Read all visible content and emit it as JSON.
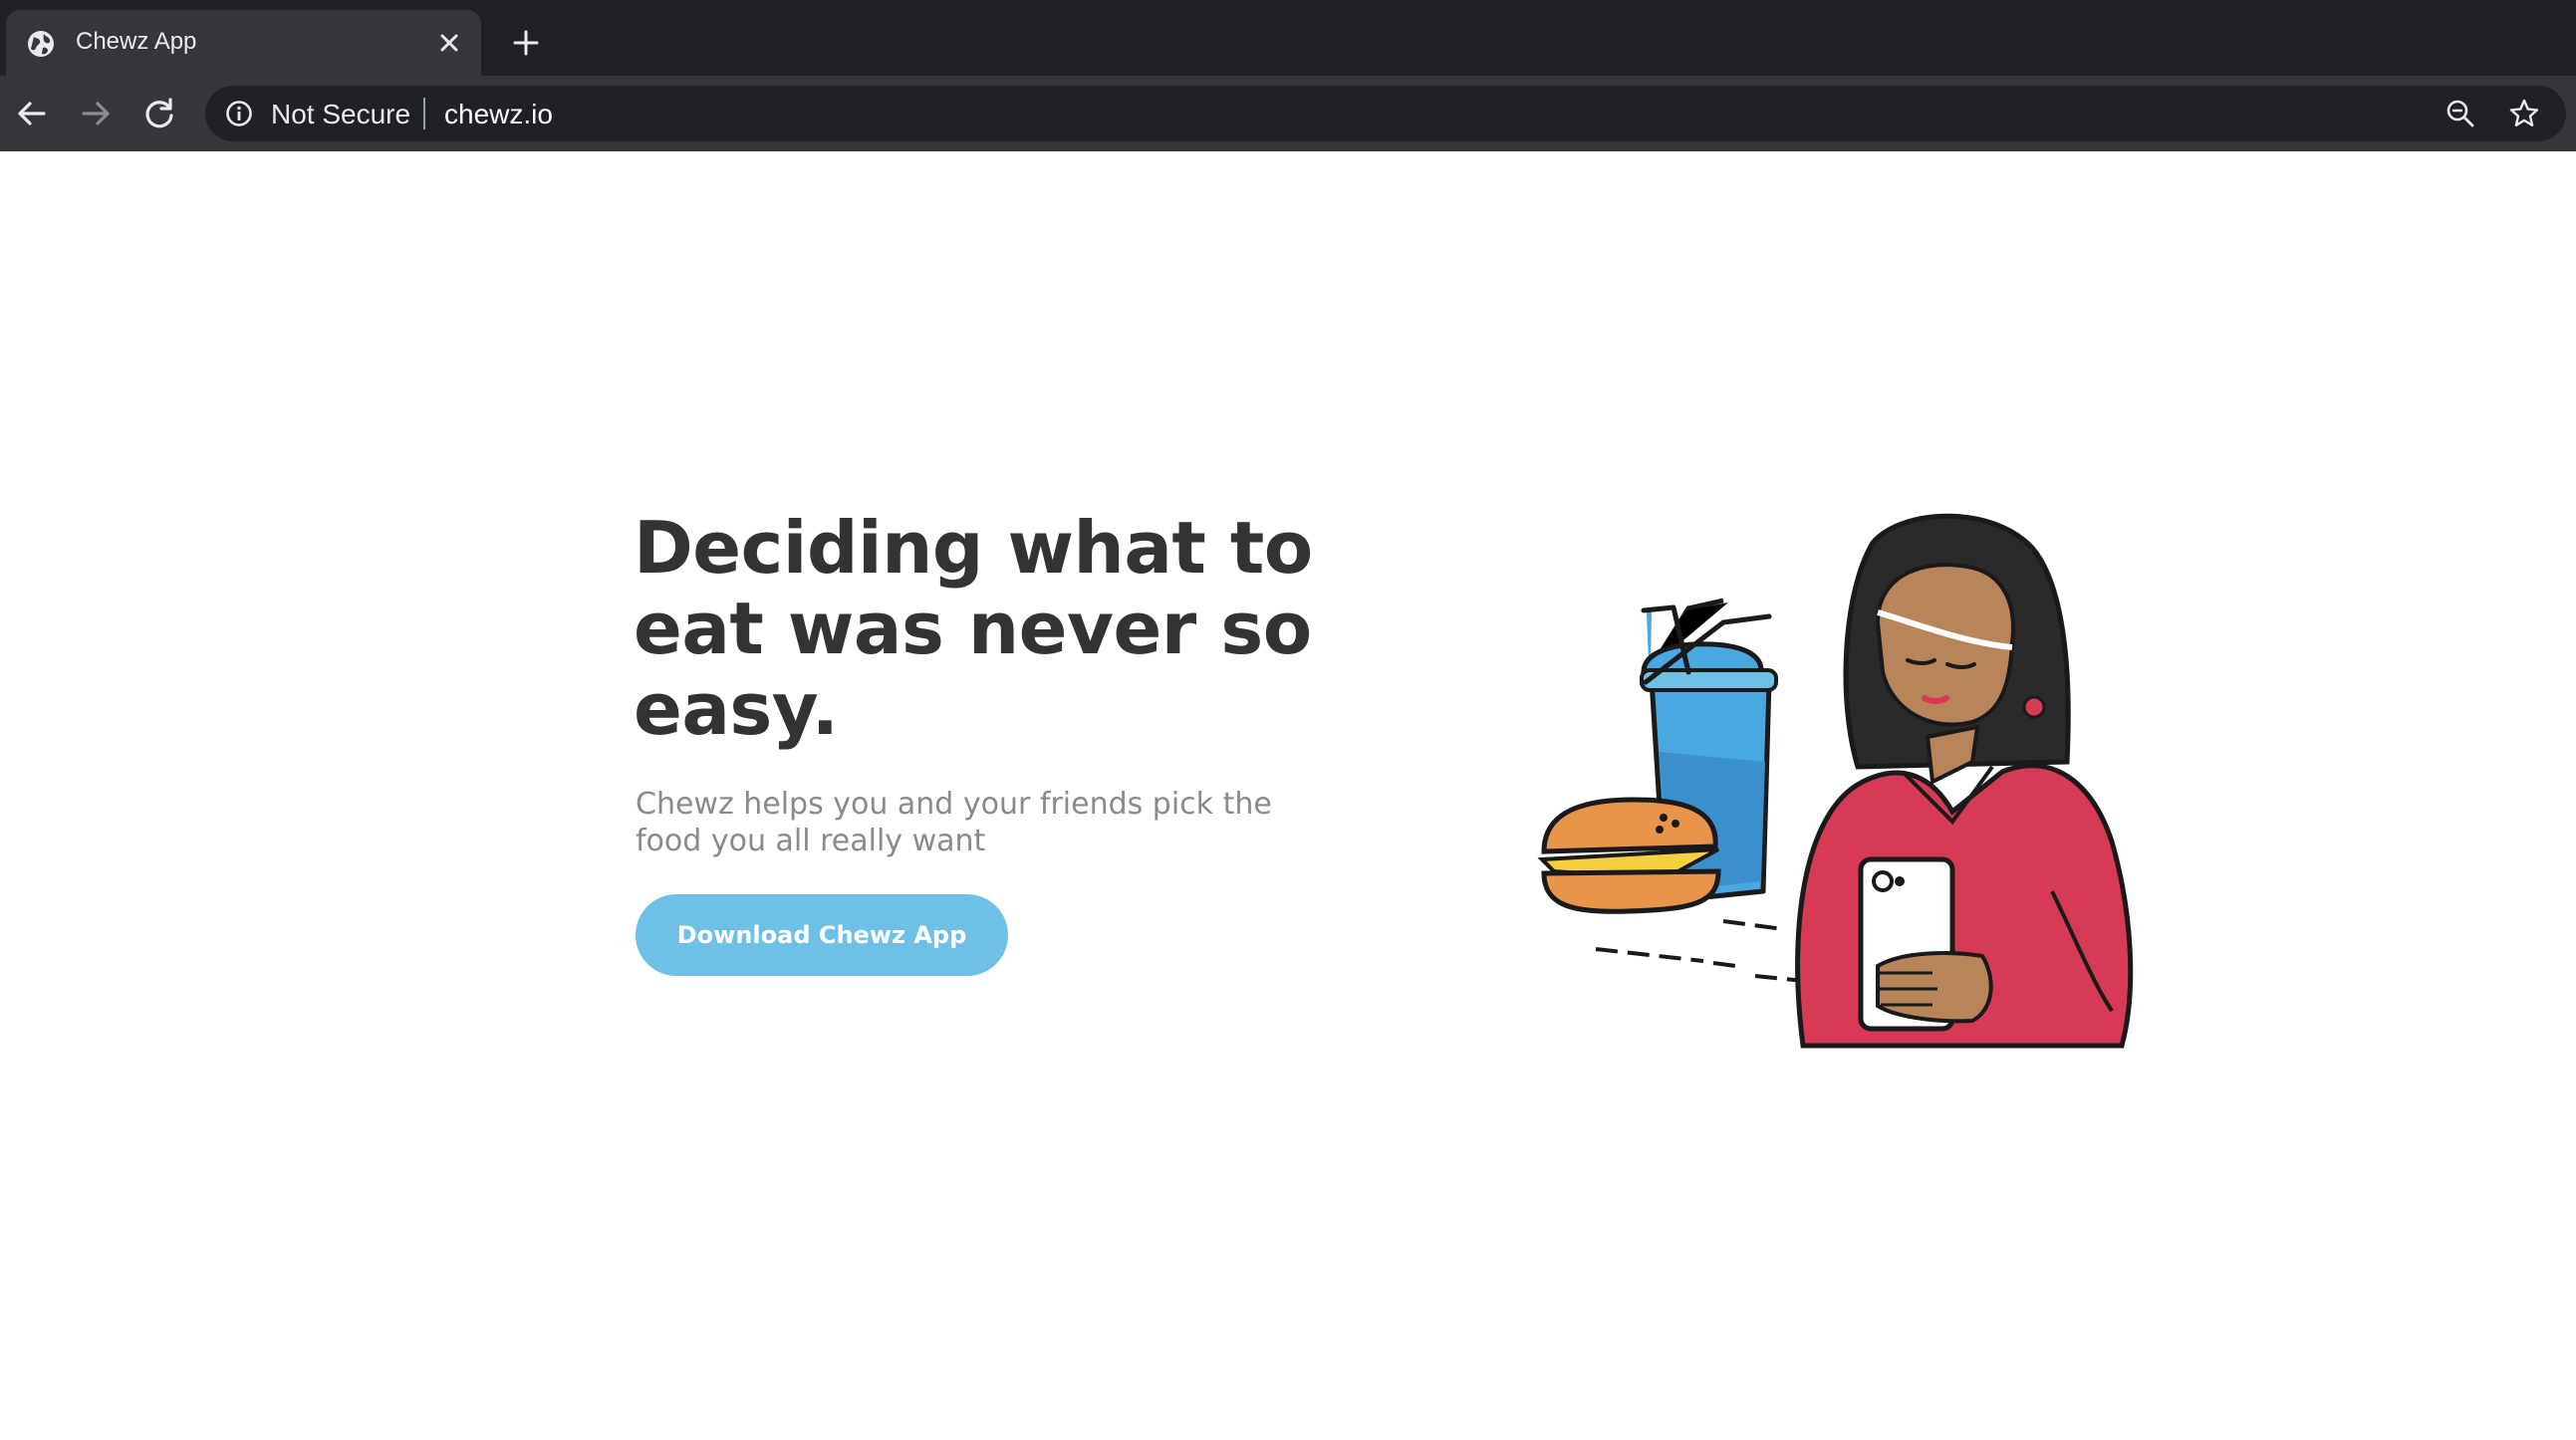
{
  "browser": {
    "tab_title": "Chewz App",
    "security_label": "Not Secure",
    "url": "chewz.io",
    "icons": [
      "globe-icon",
      "close-icon",
      "plus-icon",
      "back-arrow-icon",
      "forward-arrow-icon",
      "reload-icon",
      "info-icon",
      "zoom-icon",
      "star-icon"
    ]
  },
  "hero": {
    "title": "Deciding what to eat was never so easy.",
    "subtitle": "Chewz helps you and your friends pick the food you all really want",
    "cta_label": "Download Chewz App"
  },
  "colors": {
    "chrome_bg": "#202124",
    "toolbar_bg": "#35363a",
    "cta_bg": "#6ec0e6",
    "title_text": "#333333",
    "subtitle_text": "#8a8a8a",
    "shirt": "#d63a55",
    "drink": "#4aa8e0",
    "burger": "#e8944a"
  }
}
